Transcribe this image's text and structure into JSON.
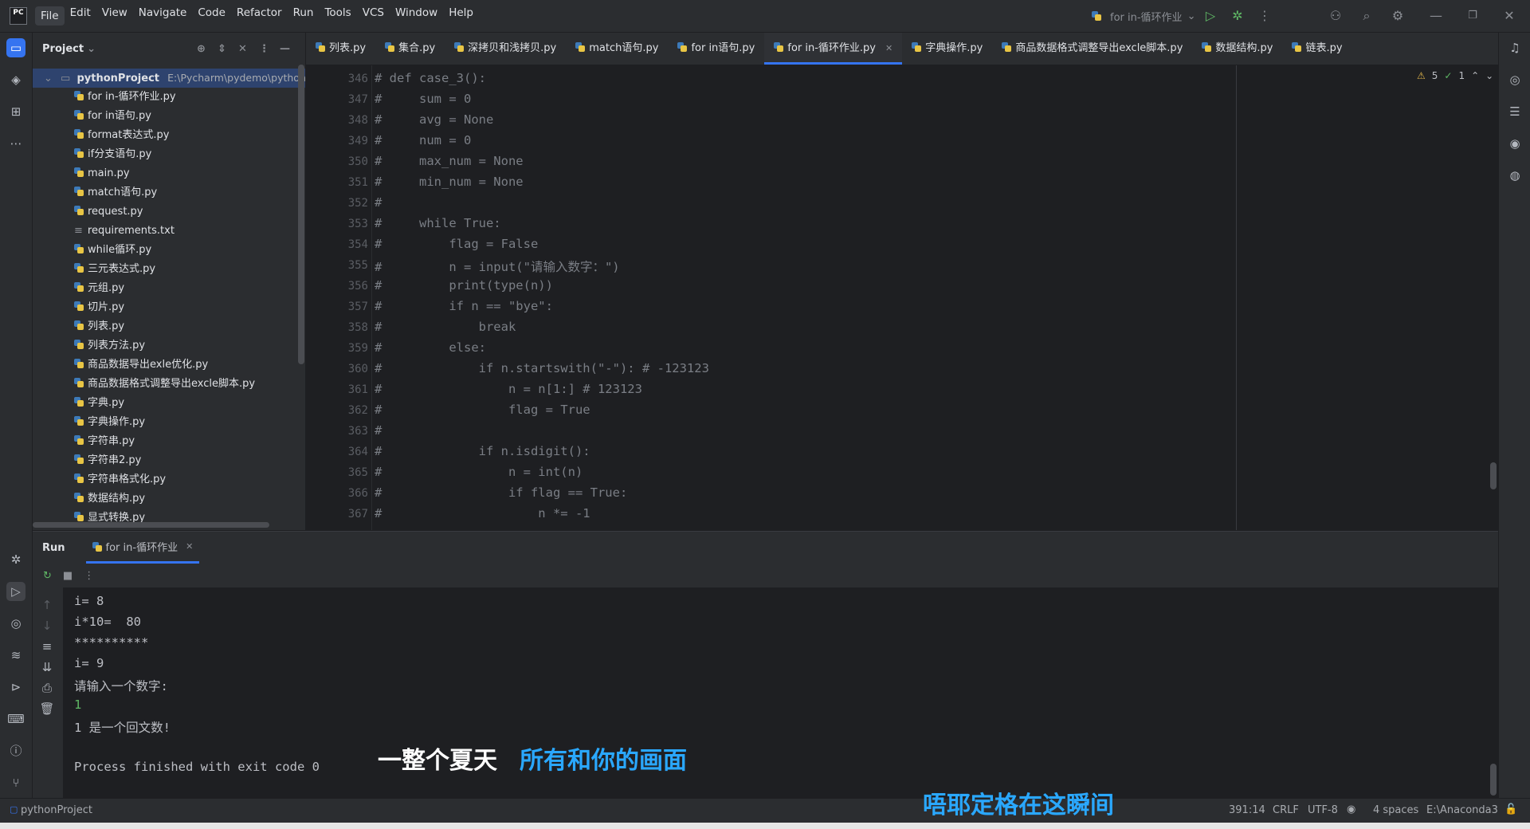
{
  "menu": [
    "File",
    "Edit",
    "View",
    "Navigate",
    "Code",
    "Refactor",
    "Run",
    "Tools",
    "VCS",
    "Window",
    "Help"
  ],
  "logo_text": "PC",
  "run_config": "for in-循环作业",
  "project": {
    "title": "Project",
    "root_name": "pythonProject",
    "root_path": "E:\\Pycharm\\pydemo\\pythonProject",
    "files": [
      "for in-循环作业.py",
      "for in语句.py",
      "format表达式.py",
      "if分支语句.py",
      "main.py",
      "match语句.py",
      "request.py",
      "requirements.txt",
      "while循环.py",
      "三元表达式.py",
      "元组.py",
      "切片.py",
      "列表.py",
      "列表方法.py",
      "商品数据导出exle优化.py",
      "商品数据格式调整导出excle脚本.py",
      "字典.py",
      "字典操作.py",
      "字符串.py",
      "字符串2.py",
      "字符串格式化.py",
      "数据结构.py",
      "显式转换.py"
    ]
  },
  "tabs": [
    "列表.py",
    "集合.py",
    "深拷贝和浅拷贝.py",
    "match语句.py",
    "for in语句.py",
    "for in-循环作业.py",
    "字典操作.py",
    "商品数据格式调整导出excle脚本.py",
    "数据结构.py",
    "链表.py"
  ],
  "active_tab": "for in-循环作业.py",
  "inspections": {
    "warnings": "5",
    "ok": "1"
  },
  "code": [
    {
      "n": "346",
      "t": "# def case_3():"
    },
    {
      "n": "347",
      "t": "#     sum = 0"
    },
    {
      "n": "348",
      "t": "#     avg = None"
    },
    {
      "n": "349",
      "t": "#     num = 0"
    },
    {
      "n": "350",
      "t": "#     max_num = None"
    },
    {
      "n": "351",
      "t": "#     min_num = None"
    },
    {
      "n": "352",
      "t": "#"
    },
    {
      "n": "353",
      "t": "#     while True:"
    },
    {
      "n": "354",
      "t": "#         flag = False"
    },
    {
      "n": "355",
      "t": "#         n = input(\"请输入数字：\")"
    },
    {
      "n": "356",
      "t": "#         print(type(n))"
    },
    {
      "n": "357",
      "t": "#         if n == \"bye\":"
    },
    {
      "n": "358",
      "t": "#             break"
    },
    {
      "n": "359",
      "t": "#         else:"
    },
    {
      "n": "360",
      "t": "#             if n.startswith(\"-\"): # -123123"
    },
    {
      "n": "361",
      "t": "#                 n = n[1:] # 123123"
    },
    {
      "n": "362",
      "t": "#                 flag = True"
    },
    {
      "n": "363",
      "t": "#"
    },
    {
      "n": "364",
      "t": "#             if n.isdigit():"
    },
    {
      "n": "365",
      "t": "#                 n = int(n)"
    },
    {
      "n": "366",
      "t": "#                 if flag == True:"
    },
    {
      "n": "367",
      "t": "#                     n *= -1"
    }
  ],
  "run": {
    "title": "Run",
    "tab": "for in-循环作业",
    "output": [
      {
        "t": "i= 8",
        "c": "#bcbec4"
      },
      {
        "t": "i*10=  80",
        "c": "#bcbec4"
      },
      {
        "t": "**********",
        "c": "#bcbec4"
      },
      {
        "t": "i= 9",
        "c": "#bcbec4"
      },
      {
        "t": "请输入一个数字:",
        "c": "#bcbec4"
      },
      {
        "t": "1",
        "c": "#5fb865"
      },
      {
        "t": "1 是一个回文数!",
        "c": "#bcbec4"
      },
      {
        "t": "",
        "c": "#bcbec4"
      },
      {
        "t": "Process finished with exit code 0",
        "c": "#bcbec4"
      }
    ]
  },
  "subtitles": {
    "line1_a": "一整个夏天",
    "line1_b": "所有和你的画面",
    "line2": "唔耶定格在这瞬间"
  },
  "status": {
    "project": "pythonProject",
    "position": "391:14",
    "line_sep": "CRLF",
    "encoding": "UTF-8",
    "indent": "4 spaces",
    "interpreter": "E:\\Anaconda3"
  },
  "colors": {
    "accent": "#3574f0",
    "subtitle_white": "#ffffff",
    "subtitle_blue": "#2aa8ff",
    "string_green": "#5fb865"
  }
}
